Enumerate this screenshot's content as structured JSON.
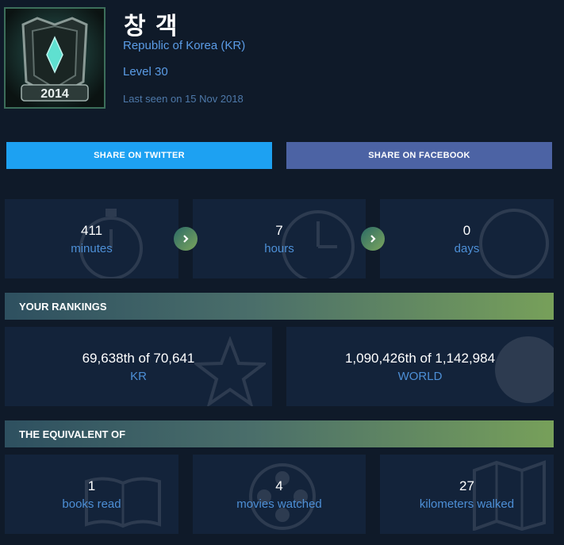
{
  "profile": {
    "name": "창 객",
    "region": "Republic of Korea (KR)",
    "level": "Level 30",
    "last_seen": "Last seen on 15 Nov 2018",
    "avatar_badge": "2014"
  },
  "share": {
    "twitter_label": "SHARE ON TWITTER",
    "facebook_label": "SHARE ON FACEBOOK"
  },
  "time_played": [
    {
      "value": "411",
      "unit": "minutes",
      "icon": "stopwatch-icon"
    },
    {
      "value": "7",
      "unit": "hours",
      "icon": "clock-icon"
    },
    {
      "value": "0",
      "unit": "days",
      "icon": "circle-icon"
    }
  ],
  "rankings": {
    "title": "YOUR RANKINGS",
    "items": [
      {
        "rank": "69,638th of 70,641",
        "scope": "KR",
        "icon": "star-icon"
      },
      {
        "rank": "1,090,426th of 1,142,984",
        "scope": "WORLD",
        "icon": "globe-icon"
      }
    ]
  },
  "equivalent": {
    "title": "THE EQUIVALENT OF",
    "items": [
      {
        "value": "1",
        "label": "books read",
        "icon": "book-icon"
      },
      {
        "value": "4",
        "label": "movies watched",
        "icon": "film-reel-icon"
      },
      {
        "value": "27",
        "label": "kilometers walked",
        "icon": "map-icon"
      }
    ]
  },
  "colors": {
    "background": "#0f1a29",
    "tile": "#13233a",
    "twitter": "#1da1f2",
    "facebook": "#4c63a4",
    "accent_blue": "#5b9ce6",
    "bar_gradient_end": "#77a05a"
  }
}
